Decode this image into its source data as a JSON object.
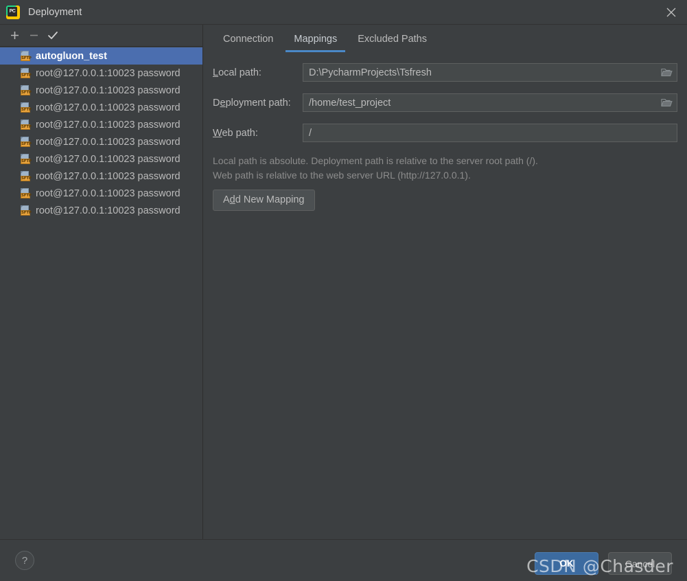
{
  "window": {
    "title": "Deployment",
    "app_icon": "pycharm-logo-icon",
    "close_icon": "close-icon"
  },
  "toolbar": {
    "add_label": "+",
    "remove_label": "−",
    "apply_label": "✓",
    "add_icon": "plus-icon",
    "remove_icon": "minus-icon",
    "apply_icon": "check-icon"
  },
  "server_list": {
    "items": [
      {
        "label": "autogluon_test",
        "icon": "sftp-icon",
        "badge": "SFTP",
        "selected": true
      },
      {
        "label": "root@127.0.0.1:10023 password",
        "icon": "sftp-icon",
        "badge": "SFTP",
        "selected": false
      },
      {
        "label": "root@127.0.0.1:10023 password",
        "icon": "sftp-icon",
        "badge": "SFTP",
        "selected": false
      },
      {
        "label": "root@127.0.0.1:10023 password",
        "icon": "sftp-icon",
        "badge": "SFTP",
        "selected": false
      },
      {
        "label": "root@127.0.0.1:10023 password",
        "icon": "sftp-icon",
        "badge": "SFTP",
        "selected": false
      },
      {
        "label": "root@127.0.0.1:10023 password",
        "icon": "sftp-icon",
        "badge": "SFTP",
        "selected": false
      },
      {
        "label": "root@127.0.0.1:10023 password",
        "icon": "sftp-icon",
        "badge": "SFTP",
        "selected": false
      },
      {
        "label": "root@127.0.0.1:10023 password",
        "icon": "sftp-icon",
        "badge": "SFTP",
        "selected": false
      },
      {
        "label": "root@127.0.0.1:10023 password",
        "icon": "sftp-icon",
        "badge": "SFTP",
        "selected": false
      },
      {
        "label": "root@127.0.0.1:10023 password",
        "icon": "sftp-icon",
        "badge": "SFTP",
        "selected": false
      }
    ]
  },
  "tabs": [
    {
      "label": "Connection",
      "active": false
    },
    {
      "label": "Mappings",
      "active": true
    },
    {
      "label": "Excluded Paths",
      "active": false
    }
  ],
  "mappings_form": {
    "local_path": {
      "label_mnemonic": "L",
      "label_rest": "ocal path:",
      "value": "D:\\PycharmProjects\\Tsfresh",
      "has_browse": true,
      "browse_icon": "folder-icon"
    },
    "deployment_path": {
      "label_pre": "D",
      "label_mnemonic": "e",
      "label_rest": "ployment path:",
      "value": "/home/test_project",
      "has_browse": true,
      "browse_icon": "folder-icon"
    },
    "web_path": {
      "label_mnemonic": "W",
      "label_rest": "eb path:",
      "value": "/",
      "has_browse": false
    },
    "hint_line1": "Local path is absolute. Deployment path is relative to the server root path (/).",
    "hint_line2": "Web path is relative to the web server URL (http://127.0.0.1).",
    "add_mapping": {
      "pre": "A",
      "mnemonic": "d",
      "rest": "d New Mapping"
    }
  },
  "bottom": {
    "help_label": "?",
    "help_icon": "question-mark-icon",
    "ok_label": "OK",
    "cancel_label": "Cancel"
  },
  "watermark": {
    "text": "CSDN @Chasder"
  },
  "colors": {
    "background": "#3c3f41",
    "selection": "#4b6eaf",
    "tab_underline": "#4a88c7",
    "primary_button": "#3c6ba0",
    "field_background": "#45494a",
    "sftp_badge": "#e8a33d"
  }
}
